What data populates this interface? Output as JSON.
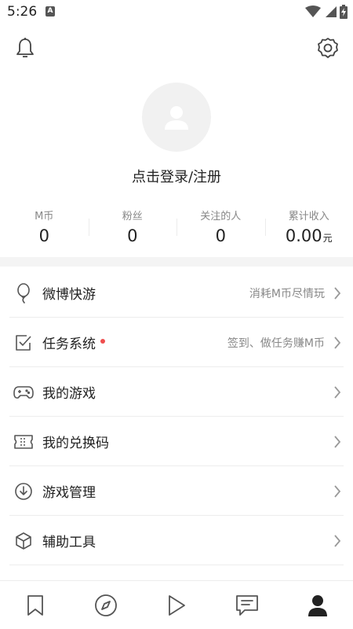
{
  "status_bar": {
    "time": "5:26",
    "notification_icon": "a-app-icon",
    "icons": [
      "wifi-icon",
      "signal-icon",
      "battery-charging-icon"
    ]
  },
  "header": {
    "notification_icon": "bell-icon",
    "settings_icon": "gear-icon"
  },
  "profile": {
    "avatar_icon": "user-placeholder-icon",
    "login_text": "点击登录/注册"
  },
  "stats": [
    {
      "label": "M币",
      "value": "0",
      "unit": ""
    },
    {
      "label": "粉丝",
      "value": "0",
      "unit": ""
    },
    {
      "label": "关注的人",
      "value": "0",
      "unit": ""
    },
    {
      "label": "累计收入",
      "value": "0.00",
      "unit": "元"
    }
  ],
  "menu": [
    {
      "label": "微博快游",
      "hint": "消耗M币尽情玩",
      "icon": "balloon-icon",
      "badge_dot": false
    },
    {
      "label": "任务系统",
      "hint": "签到、做任务赚M币",
      "icon": "checkbox-icon",
      "badge_dot": true
    },
    {
      "label": "我的游戏",
      "hint": "",
      "icon": "gamepad-icon",
      "badge_dot": false
    },
    {
      "label": "我的兑换码",
      "hint": "",
      "icon": "ticket-icon",
      "badge_dot": false
    },
    {
      "label": "游戏管理",
      "hint": "",
      "icon": "download-circle-icon",
      "badge_dot": false
    },
    {
      "label": "辅助工具",
      "hint": "",
      "icon": "cube-icon",
      "badge_dot": false
    }
  ],
  "tab_bar": {
    "tabs": [
      {
        "icon": "bookmark-icon",
        "active": false
      },
      {
        "icon": "compass-icon",
        "active": false
      },
      {
        "icon": "play-icon",
        "active": false
      },
      {
        "icon": "message-icon",
        "active": false
      },
      {
        "icon": "profile-icon",
        "active": true
      }
    ]
  },
  "colors": {
    "accent_dot": "#ef4d4d",
    "text_primary": "#222222",
    "text_secondary": "#888888",
    "divider": "#ededed",
    "section_bg": "#f4f4f4",
    "avatar_bg": "#f1f1f1"
  }
}
